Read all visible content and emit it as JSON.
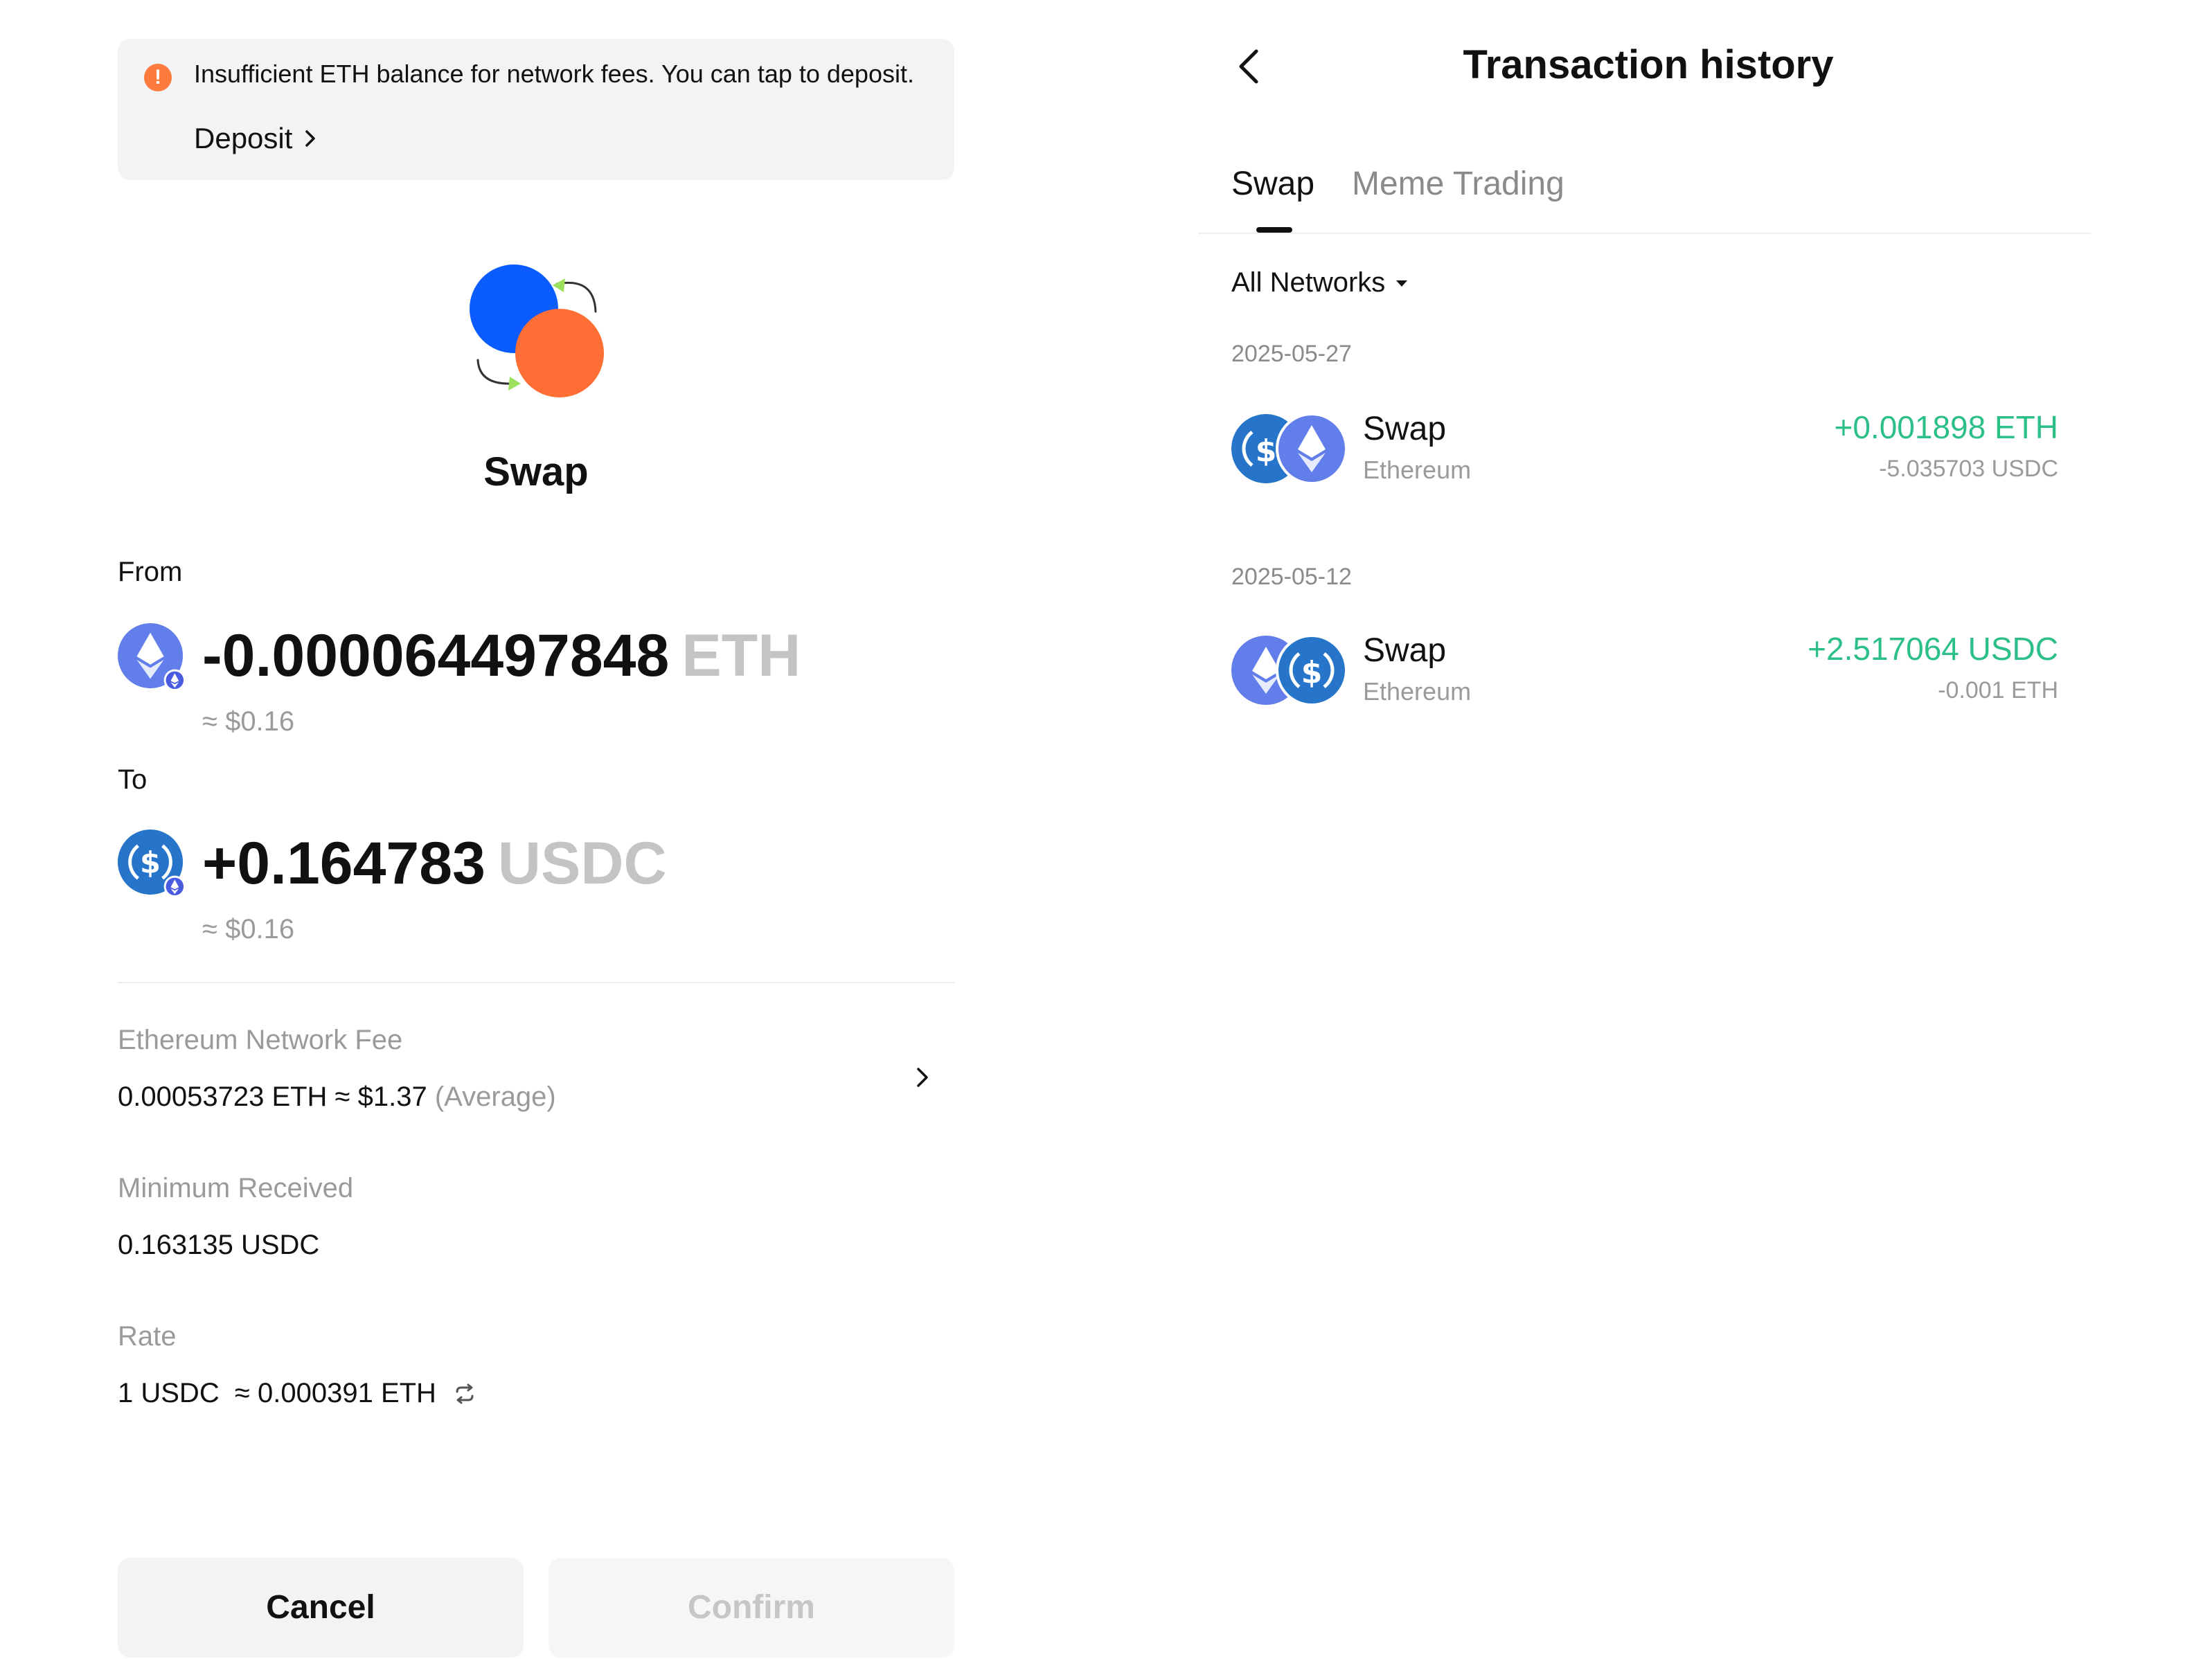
{
  "warning": {
    "text": "Insufficient ETH balance for network fees. You can tap to deposit.",
    "icon": "alert-icon",
    "deposit_label": "Deposit"
  },
  "swap": {
    "title": "Swap",
    "from": {
      "label": "From",
      "amount": "-0.000064497848",
      "symbol": "ETH",
      "usd": "≈ $0.16"
    },
    "to": {
      "label": "To",
      "amount": "+0.164783",
      "symbol": "USDC",
      "usd": "≈ $0.16"
    },
    "fee": {
      "label": "Ethereum Network Fee",
      "value": "0.00053723 ETH ≈ $1.37",
      "speed": "(Average)"
    },
    "minimum": {
      "label": "Minimum Received",
      "value": "0.163135 USDC"
    },
    "rate": {
      "label": "Rate",
      "value": "1 USDC  ≈ 0.000391 ETH"
    },
    "buttons": {
      "cancel": "Cancel",
      "confirm": "Confirm"
    }
  },
  "history": {
    "title": "Transaction history",
    "tabs": [
      "Swap",
      "Meme Trading"
    ],
    "active_tab": "Swap",
    "filter": "All Networks",
    "groups": [
      {
        "date": "2025-05-27",
        "items": [
          {
            "title": "Swap",
            "network": "Ethereum",
            "amount": "+0.001898 ETH",
            "sub": "-5.035703 USDC",
            "icons": [
              "usdc-icon",
              "eth-icon"
            ]
          }
        ]
      },
      {
        "date": "2025-05-12",
        "items": [
          {
            "title": "Swap",
            "network": "Ethereum",
            "amount": "+2.517064 USDC",
            "sub": "-0.001 ETH",
            "icons": [
              "eth-icon",
              "usdc-icon"
            ]
          }
        ]
      }
    ]
  },
  "colors": {
    "positive": "#2cbf87",
    "eth": "#627eea",
    "usdc": "#2775ca",
    "warning": "#ff7a3d",
    "hero_blue": "#0a5cff",
    "hero_orange": "#ff6e35"
  }
}
